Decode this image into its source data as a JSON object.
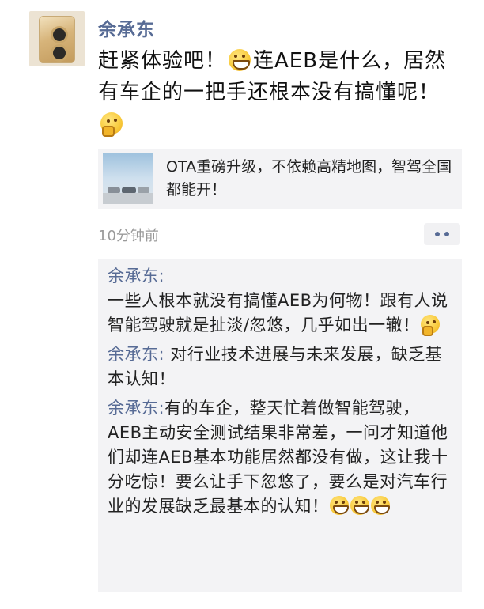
{
  "post": {
    "author": "余承东",
    "text_part1": "赶紧体验吧！",
    "text_part2": "连AEB是什么，居然有车企的一把手还根本没有搞懂呢！",
    "emojis": [
      "grin-icon",
      "thinking-icon"
    ]
  },
  "link_card": {
    "title": "OTA重磅升级，不依赖高精地图，智驾全国都能开！"
  },
  "meta": {
    "time": "10分钟前"
  },
  "comments": [
    {
      "author": "余承东:",
      "text": "一些人根本就没有搞懂AEB为何物！跟有人说智能驾驶就是扯淡/忽悠，几乎如出一辙！",
      "emoji": "thinking-icon"
    },
    {
      "author": "余承东:",
      "text": "对行业技术进展与未来发展，缺乏基本认知！"
    },
    {
      "author": "余承东:",
      "text": "有的车企，整天忙着做智能驾驶，AEB主动安全测试结果非常差，一问才知道他们却连AEB基本功能居然都没有做，这让我十分吃惊！要么让手下忽悠了，要么是对汽车行业的发展缺乏最基本的认知！",
      "emoji": "grin-icon x3"
    }
  ],
  "colors": {
    "name_blue": "#576b95",
    "comment_bg": "#f3f3f5",
    "time_gray": "#9a9a9a"
  }
}
